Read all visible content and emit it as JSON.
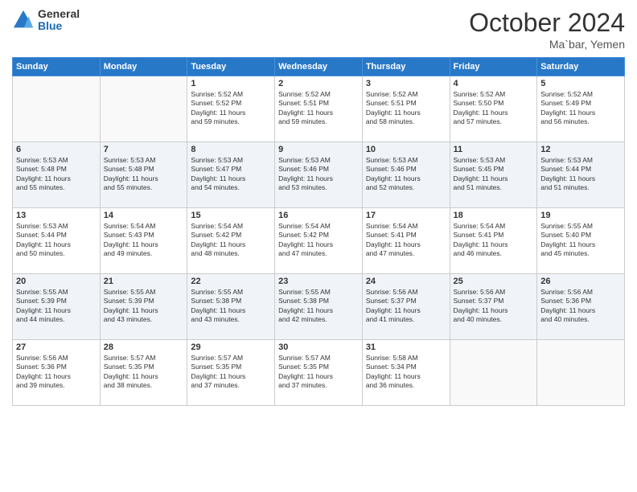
{
  "header": {
    "logo_general": "General",
    "logo_blue": "Blue",
    "month_title": "October 2024",
    "location": "Ma`bar, Yemen"
  },
  "days_of_week": [
    "Sunday",
    "Monday",
    "Tuesday",
    "Wednesday",
    "Thursday",
    "Friday",
    "Saturday"
  ],
  "weeks": [
    [
      {
        "day": "",
        "info": ""
      },
      {
        "day": "",
        "info": ""
      },
      {
        "day": "1",
        "info": "Sunrise: 5:52 AM\nSunset: 5:52 PM\nDaylight: 11 hours\nand 59 minutes."
      },
      {
        "day": "2",
        "info": "Sunrise: 5:52 AM\nSunset: 5:51 PM\nDaylight: 11 hours\nand 59 minutes."
      },
      {
        "day": "3",
        "info": "Sunrise: 5:52 AM\nSunset: 5:51 PM\nDaylight: 11 hours\nand 58 minutes."
      },
      {
        "day": "4",
        "info": "Sunrise: 5:52 AM\nSunset: 5:50 PM\nDaylight: 11 hours\nand 57 minutes."
      },
      {
        "day": "5",
        "info": "Sunrise: 5:52 AM\nSunset: 5:49 PM\nDaylight: 11 hours\nand 56 minutes."
      }
    ],
    [
      {
        "day": "6",
        "info": "Sunrise: 5:53 AM\nSunset: 5:48 PM\nDaylight: 11 hours\nand 55 minutes."
      },
      {
        "day": "7",
        "info": "Sunrise: 5:53 AM\nSunset: 5:48 PM\nDaylight: 11 hours\nand 55 minutes."
      },
      {
        "day": "8",
        "info": "Sunrise: 5:53 AM\nSunset: 5:47 PM\nDaylight: 11 hours\nand 54 minutes."
      },
      {
        "day": "9",
        "info": "Sunrise: 5:53 AM\nSunset: 5:46 PM\nDaylight: 11 hours\nand 53 minutes."
      },
      {
        "day": "10",
        "info": "Sunrise: 5:53 AM\nSunset: 5:46 PM\nDaylight: 11 hours\nand 52 minutes."
      },
      {
        "day": "11",
        "info": "Sunrise: 5:53 AM\nSunset: 5:45 PM\nDaylight: 11 hours\nand 51 minutes."
      },
      {
        "day": "12",
        "info": "Sunrise: 5:53 AM\nSunset: 5:44 PM\nDaylight: 11 hours\nand 51 minutes."
      }
    ],
    [
      {
        "day": "13",
        "info": "Sunrise: 5:53 AM\nSunset: 5:44 PM\nDaylight: 11 hours\nand 50 minutes."
      },
      {
        "day": "14",
        "info": "Sunrise: 5:54 AM\nSunset: 5:43 PM\nDaylight: 11 hours\nand 49 minutes."
      },
      {
        "day": "15",
        "info": "Sunrise: 5:54 AM\nSunset: 5:42 PM\nDaylight: 11 hours\nand 48 minutes."
      },
      {
        "day": "16",
        "info": "Sunrise: 5:54 AM\nSunset: 5:42 PM\nDaylight: 11 hours\nand 47 minutes."
      },
      {
        "day": "17",
        "info": "Sunrise: 5:54 AM\nSunset: 5:41 PM\nDaylight: 11 hours\nand 47 minutes."
      },
      {
        "day": "18",
        "info": "Sunrise: 5:54 AM\nSunset: 5:41 PM\nDaylight: 11 hours\nand 46 minutes."
      },
      {
        "day": "19",
        "info": "Sunrise: 5:55 AM\nSunset: 5:40 PM\nDaylight: 11 hours\nand 45 minutes."
      }
    ],
    [
      {
        "day": "20",
        "info": "Sunrise: 5:55 AM\nSunset: 5:39 PM\nDaylight: 11 hours\nand 44 minutes."
      },
      {
        "day": "21",
        "info": "Sunrise: 5:55 AM\nSunset: 5:39 PM\nDaylight: 11 hours\nand 43 minutes."
      },
      {
        "day": "22",
        "info": "Sunrise: 5:55 AM\nSunset: 5:38 PM\nDaylight: 11 hours\nand 43 minutes."
      },
      {
        "day": "23",
        "info": "Sunrise: 5:55 AM\nSunset: 5:38 PM\nDaylight: 11 hours\nand 42 minutes."
      },
      {
        "day": "24",
        "info": "Sunrise: 5:56 AM\nSunset: 5:37 PM\nDaylight: 11 hours\nand 41 minutes."
      },
      {
        "day": "25",
        "info": "Sunrise: 5:56 AM\nSunset: 5:37 PM\nDaylight: 11 hours\nand 40 minutes."
      },
      {
        "day": "26",
        "info": "Sunrise: 5:56 AM\nSunset: 5:36 PM\nDaylight: 11 hours\nand 40 minutes."
      }
    ],
    [
      {
        "day": "27",
        "info": "Sunrise: 5:56 AM\nSunset: 5:36 PM\nDaylight: 11 hours\nand 39 minutes."
      },
      {
        "day": "28",
        "info": "Sunrise: 5:57 AM\nSunset: 5:35 PM\nDaylight: 11 hours\nand 38 minutes."
      },
      {
        "day": "29",
        "info": "Sunrise: 5:57 AM\nSunset: 5:35 PM\nDaylight: 11 hours\nand 37 minutes."
      },
      {
        "day": "30",
        "info": "Sunrise: 5:57 AM\nSunset: 5:35 PM\nDaylight: 11 hours\nand 37 minutes."
      },
      {
        "day": "31",
        "info": "Sunrise: 5:58 AM\nSunset: 5:34 PM\nDaylight: 11 hours\nand 36 minutes."
      },
      {
        "day": "",
        "info": ""
      },
      {
        "day": "",
        "info": ""
      }
    ]
  ]
}
